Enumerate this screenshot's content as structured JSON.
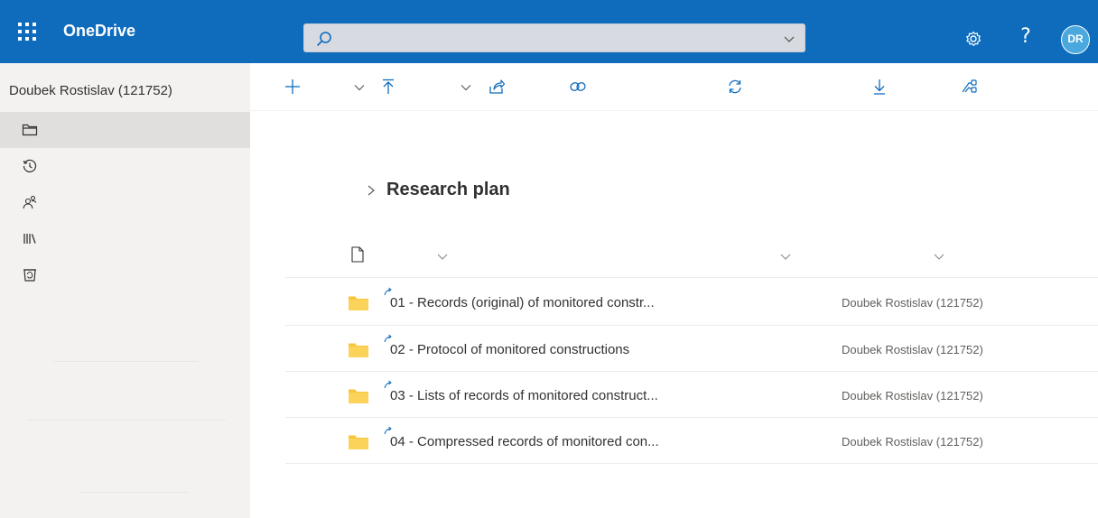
{
  "app": {
    "name": "OneDrive"
  },
  "search": {
    "placeholder": "",
    "value": ""
  },
  "header": {
    "avatar_initials": "DR",
    "help_glyph": "?"
  },
  "user": {
    "name": "Doubek Rostislav (121752)"
  },
  "nav": {
    "items": [
      {
        "icon": "folder-icon",
        "selected": true
      },
      {
        "icon": "recent-icon",
        "selected": false
      },
      {
        "icon": "shared-icon",
        "selected": false
      },
      {
        "icon": "libraries-icon",
        "selected": false
      },
      {
        "icon": "recycle-bin-icon",
        "selected": false
      }
    ]
  },
  "commands": [
    {
      "icon": "add-icon",
      "has_dropdown": true
    },
    {
      "icon": "upload-icon",
      "has_dropdown": true
    },
    {
      "icon": "share-icon",
      "has_dropdown": false
    },
    {
      "icon": "copy-link-icon",
      "has_dropdown": false
    },
    {
      "icon": "sync-icon",
      "has_dropdown": false
    },
    {
      "icon": "download-icon",
      "has_dropdown": false
    },
    {
      "icon": "flow-icon",
      "has_dropdown": false
    }
  ],
  "breadcrumb": {
    "title": "Research plan"
  },
  "columns": {
    "name_label": "",
    "modified_label": "",
    "modified_by_label": ""
  },
  "files": [
    {
      "name": "01 - Records (original) of monitored constr...",
      "modified_by": "Doubek Rostislav (121752)",
      "type": "folder"
    },
    {
      "name": "02 - Protocol of monitored constructions",
      "modified_by": "Doubek Rostislav (121752)",
      "type": "folder"
    },
    {
      "name": "03 - Lists of records of monitored construct...",
      "modified_by": "Doubek Rostislav (121752)",
      "type": "folder"
    },
    {
      "name": "04 - Compressed records of monitored con...",
      "modified_by": "Doubek Rostislav (121752)",
      "type": "folder"
    }
  ],
  "colors": {
    "suite_bar": "#0f6cbd",
    "folder": "#f8c63a",
    "nav_background": "#f3f2f1",
    "nav_selected": "#e1dfdd"
  }
}
